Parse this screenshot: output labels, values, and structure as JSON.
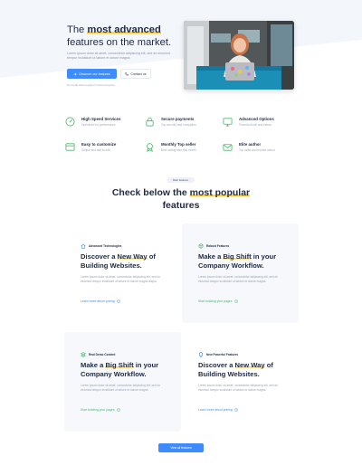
{
  "hero": {
    "title_prefix": "The ",
    "title_highlight": "most advanced",
    "title_suffix": " features on the market.",
    "description": "Lorem ipsum dolor sit amet, consectetur adipiscing elit, sed do eiusmod tempor incididunt ut labore et dolore magna.",
    "primary_button": "Discover our features",
    "secondary_button": "Contact us",
    "note": "No credit card required. Cancel anytime.",
    "photo_icon": "woman-with-laptop-photo"
  },
  "features": [
    {
      "title": "High Speed Services",
      "subtitle": "Optimized for performance",
      "icon": "speedometer-icon",
      "color": "#4cb96b"
    },
    {
      "title": "Secure payments",
      "subtitle": "Top security and encryption",
      "icon": "lock-icon",
      "color": "#4cb96b"
    },
    {
      "title": "Advanced Options",
      "subtitle": "Powerful tools and extras",
      "icon": "monitor-icon",
      "color": "#4cb96b"
    },
    {
      "title": "Easy to customize",
      "subtitle": "Simple and fast to edit",
      "icon": "browser-window-icon",
      "color": "#4cb96b"
    },
    {
      "title": "Monthly Top seller",
      "subtitle": "Best selling item this month",
      "icon": "award-icon",
      "color": "#4cb96b"
    },
    {
      "title": "Elite author",
      "subtitle": "Top rated and trusted author",
      "icon": "mail-icon",
      "color": "#4cb96b"
    }
  ],
  "section": {
    "pill": "Main features",
    "title_prefix": "Check below the ",
    "title_highlight": "most popular",
    "title_suffix": " features"
  },
  "cards": [
    {
      "tag": "Advanced Technologies",
      "tag_icon": "home-icon",
      "tag_color": "#3d8bfd",
      "title_prefix": "Discover a ",
      "title_highlight": "New Way",
      "title_suffix": " of Building Websites.",
      "description": "Lorem ipsum dolor sit amet, consectetur adipiscing elit, sed do eiusmod tempor incididunt ut labore et dolore magna aliqua.",
      "link": "Learn more about pricing",
      "link_color": "blue"
    },
    {
      "tag": "Robust Features",
      "tag_icon": "box-icon",
      "tag_color": "#46b96b",
      "title_prefix": "Make a ",
      "title_highlight": "Big Shift",
      "title_suffix": " in your Company Workflow.",
      "description": "Lorem ipsum dolor sit amet, consectetur adipiscing elit, sed do eiusmod tempor incididunt ut labore et dolore magna.",
      "link": "Start building your pages",
      "link_color": "green"
    },
    {
      "tag": "Real Demo Content",
      "tag_icon": "layers-icon",
      "tag_color": "#46b96b",
      "title_prefix": "Make a ",
      "title_highlight": "Big Shift",
      "title_suffix": " in your Company Workflow.",
      "description": "Lorem ipsum dolor sit amet, consectetur adipiscing elit, sed do eiusmod tempor incididunt ut labore et dolore magna.",
      "link": "Start building your pages",
      "link_color": "green"
    },
    {
      "tag": "New Powerful Features",
      "tag_icon": "lightbulb-icon",
      "tag_color": "#3d8bfd",
      "title_prefix": "Discover a ",
      "title_highlight": "New Way",
      "title_suffix": " of Building Websites.",
      "description": "Lorem ipsum dolor sit amet, consectetur adipiscing elit, sed do eiusmod tempor incididunt ut labore et dolore magna.",
      "link": "Learn more about pricing",
      "link_color": "blue"
    }
  ],
  "more_button": "View all features",
  "colors": {
    "accent": "#3d8bfd",
    "green": "#46b96b",
    "highlight": "#ffd23f",
    "text": "#1f2a44"
  }
}
